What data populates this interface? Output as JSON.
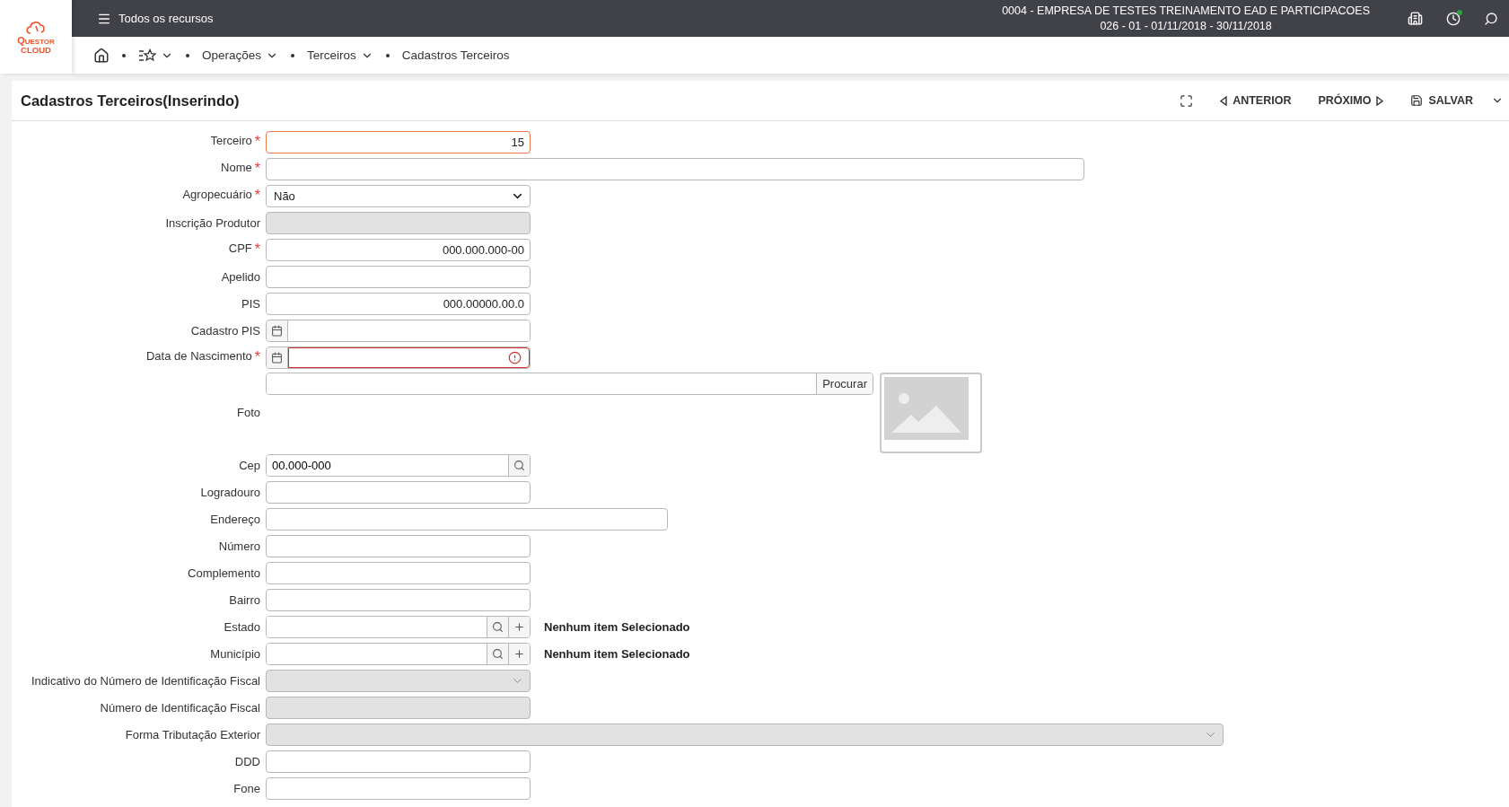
{
  "logo": {
    "line1": "Questor",
    "line2": "CLOUD"
  },
  "topbar": {
    "menu_label": "Todos os recursos",
    "company": "0004 - EMPRESA DE TESTES TREINAMENTO EAD E PARTICIPACOES",
    "period": "026 - 01 - 01/11/2018 - 30/11/2018",
    "notification": true
  },
  "breadcrumb": [
    {
      "label": "Operações",
      "dropdown": true
    },
    {
      "label": "Terceiros",
      "dropdown": true
    },
    {
      "label": "Cadastros Terceiros",
      "dropdown": false
    }
  ],
  "page": {
    "title": "Cadastros Terceiros(Inserindo)",
    "actions": [
      {
        "kind": "expand"
      },
      {
        "kind": "prev",
        "label": "ANTERIOR"
      },
      {
        "kind": "next",
        "label": "PRÓXIMO"
      },
      {
        "kind": "save",
        "label": "SALVAR"
      }
    ]
  },
  "fields": [
    {
      "kind": "numeric",
      "label": "Terceiro",
      "mark": "*",
      "value": "15",
      "focused": true,
      "disabled": false
    },
    {
      "kind": "long",
      "label": "Nome",
      "mark": "*",
      "disabled": false
    },
    {
      "kind": "dropdown",
      "label": "Agropecuário",
      "mark": "*",
      "value": "Não",
      "disabled": false
    },
    {
      "kind": "short",
      "label": "Inscrição Produtor",
      "disabled": true
    },
    {
      "kind": "numeric",
      "label": "CPF",
      "mark": "*",
      "value": "000.000.000-00",
      "disabled": false
    },
    {
      "kind": "short",
      "label": "Apelido",
      "disabled": false
    },
    {
      "kind": "numeric",
      "label": "PIS",
      "value": "000.00000.00.0",
      "disabled": false
    },
    {
      "kind": "date",
      "label": "Cadastro PIS",
      "error": false
    },
    {
      "kind": "date",
      "label": "Data de Nascimento",
      "mark": "*",
      "error": true
    },
    {
      "kind": "file",
      "label": "Foto",
      "button": "Procurar"
    },
    {
      "kind": "lookup",
      "label": "Cep",
      "value": "00.000-000"
    },
    {
      "kind": "short",
      "label": "Logradouro",
      "disabled": false
    },
    {
      "kind": "medium",
      "label": "Endereço",
      "disabled": false
    },
    {
      "kind": "short",
      "label": "Número",
      "disabled": false
    },
    {
      "kind": "short",
      "label": "Complemento",
      "disabled": false
    },
    {
      "kind": "short",
      "label": "Bairro",
      "disabled": false
    },
    {
      "kind": "lookup-add",
      "label": "Estado",
      "selection": "Nenhum item Selecionado"
    },
    {
      "kind": "lookup-add",
      "label": "Município",
      "selection": "Nenhum item Selecionado"
    },
    {
      "kind": "dropdown",
      "label": "Indicativo do Número de Identificação Fiscal",
      "disabled": true
    },
    {
      "kind": "short",
      "label": "Número de Identificação Fiscal",
      "disabled": true
    },
    {
      "kind": "widedropdown",
      "label": "Forma Tributação Exterior",
      "disabled": true
    },
    {
      "kind": "short",
      "label": "DDD",
      "disabled": false
    },
    {
      "kind": "short",
      "label": "Fone",
      "disabled": false
    }
  ]
}
